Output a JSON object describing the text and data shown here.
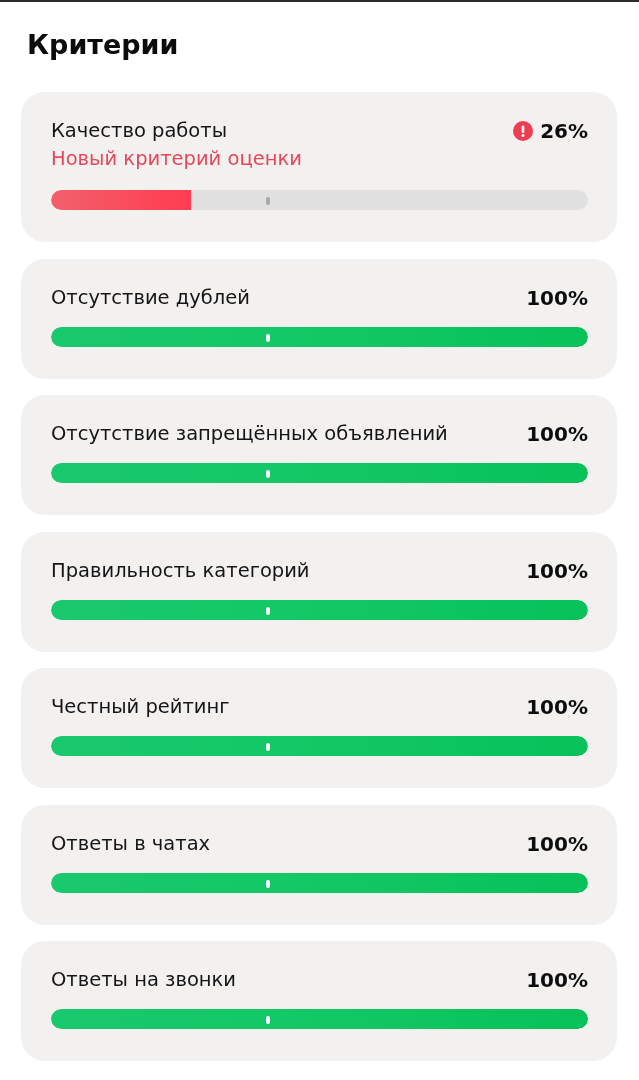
{
  "title": "Критерии",
  "criteria": [
    {
      "name": "Качество работы",
      "note": "Новый критерий оценки",
      "warning": true,
      "value": "26%",
      "level": 0.26
    },
    {
      "name": "Отсутствие дублей",
      "warning": false,
      "value": "100%",
      "level": 1
    },
    {
      "name": "Отсутствие запрещённых объявлений",
      "warning": false,
      "value": "100%",
      "level": 1
    },
    {
      "name": "Правильность категорий",
      "warning": false,
      "value": "100%",
      "level": 1
    },
    {
      "name": "Честный рейтинг",
      "warning": false,
      "value": "100%",
      "level": 1
    },
    {
      "name": "Ответы в чатах",
      "warning": false,
      "value": "100%",
      "level": 1
    },
    {
      "name": "Ответы на звонки",
      "warning": false,
      "value": "100%",
      "level": 1
    }
  ]
}
